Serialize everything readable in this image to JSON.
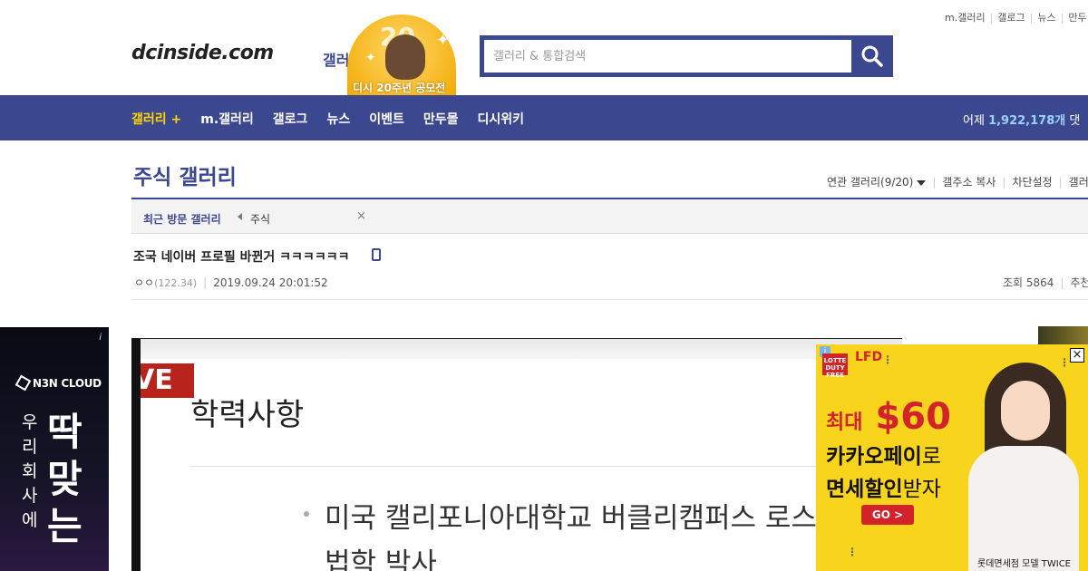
{
  "top_links": [
    "m.갤러리",
    "갤로그",
    "뉴스",
    "만두"
  ],
  "logo": {
    "site": "dcinside.com",
    "sub": "갤러리"
  },
  "badge": {
    "number": "20",
    "caption": "디시 20주년 공모전"
  },
  "search": {
    "placeholder": "갤러리 & 통합검색"
  },
  "nav": {
    "items": [
      "갤러리 +",
      "m.갤러리",
      "갤로그",
      "뉴스",
      "이벤트",
      "만두몰",
      "디시위키"
    ],
    "stat_prefix": "어제",
    "stat_value": "1,922,178개",
    "stat_suffix": "댓"
  },
  "gallery": {
    "title": "주식 갤러리",
    "tools": [
      "연관 갤러리(9/20)",
      "갤주소 복사",
      "차단설정",
      "갤러"
    ],
    "recent_label": "최근 방문 갤러리",
    "recent_item": "주식",
    "recent_close": "×"
  },
  "post": {
    "title": "조국 네이버 프로필 바뀐거 ㅋㅋㅋㅋㅋㅋ",
    "author": "ㅇㅇ",
    "ip": "(122.34)",
    "date": "2019.09.24 20:01:52",
    "views": "조회 5864",
    "recommend": "추천"
  },
  "ad_left": {
    "info": "i",
    "brand": "N3N CLOUD",
    "vertical": "우리회사에",
    "big": "딱맞는"
  },
  "main_image": {
    "live": "VE",
    "heading": "학력사항",
    "line1": "미국 캘리포니아대학교 버클리캠퍼스 로스",
    "line2": "법학 박사"
  },
  "ad_right": {
    "info": "i",
    "dutyfree": "LOTTE DUTY FREE",
    "lfd": "LFD",
    "close": "×",
    "l1_small": "최대",
    "l1_big": "$60",
    "l2_bold": "카카오페이",
    "l2_light": "로",
    "l3_bold": "면세할인",
    "l3_light": "받자",
    "go": "GO >",
    "credit": "롯데면세점 모델 TWICE"
  },
  "colors": {
    "brand": "#3b4890",
    "highlight": "#ffd400",
    "ad_yellow": "#f9d41c",
    "ad_red": "#d3232a"
  }
}
